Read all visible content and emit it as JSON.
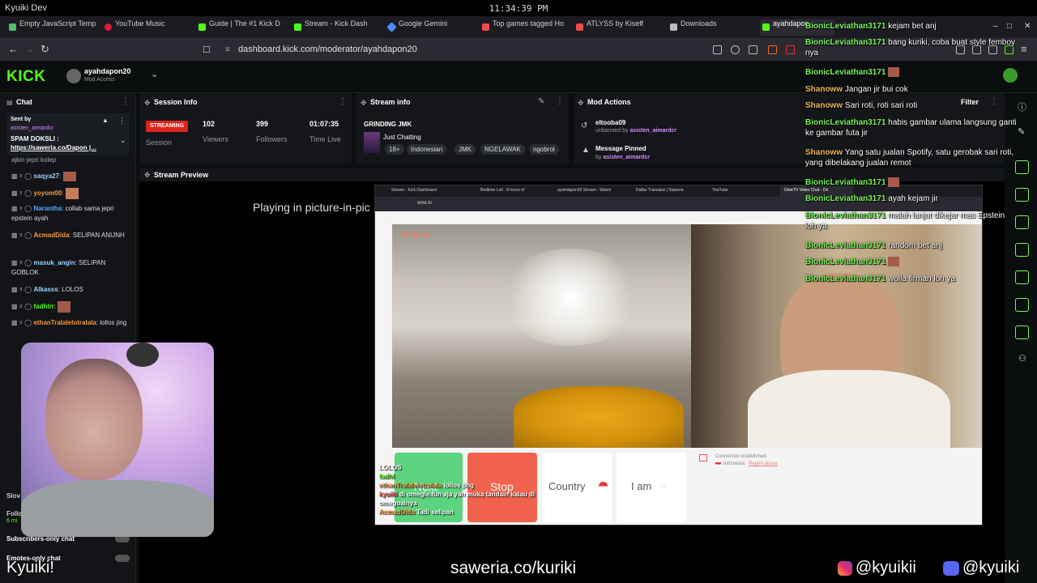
{
  "os": {
    "title": "Kyuiki Dev",
    "clock": "11:34:39 PM"
  },
  "tabs": [
    {
      "label": "Empty JavaScript Temp",
      "color": "#4fc36b"
    },
    {
      "label": "YouTube Music",
      "color": "#e21b3c"
    },
    {
      "label": "Guide | The #1 Kick D",
      "color": "#53fc18"
    },
    {
      "label": "Stream - Kick Dash",
      "color": "#53fc18"
    },
    {
      "label": "Google Gemini",
      "color": "#4a8cff"
    },
    {
      "label": "Top games tagged Ho",
      "color": "#f24a4a"
    },
    {
      "label": "ATLYSS by Kiseff",
      "color": "#f24a4a"
    },
    {
      "label": "Downloads",
      "color": "#bbbbbb"
    },
    {
      "label": "ayahdapon",
      "color": "#53fc18"
    }
  ],
  "url": "dashboard.kick.com/moderator/ayahdapon20",
  "kick": {
    "logo": "KICK",
    "channel": "ayahdapon20",
    "role": "Mod Access"
  },
  "chat": {
    "title": "Chat",
    "pinned_sent_by": "Sent by",
    "pinned_sender": "asisten_aimardcr",
    "pinned_text": "SPAM DOKSLI :",
    "pinned_link": "https://saweria.co/Dapon |...",
    "partial_top": "ajkin jepri kolep",
    "lines": [
      {
        "user": "saqya27",
        "msg": "",
        "color": "#9ad2ff"
      },
      {
        "user": "yoyom00",
        "msg": "",
        "color": "#f79a45"
      },
      {
        "user": "Narantha",
        "msg": "collab sama jepri epstein ayah",
        "color": "#57a6ff"
      },
      {
        "user": "AcmadDida",
        "msg": "SELIPAN ANIJNH",
        "color": "#f79a45"
      },
      {
        "user": "masuk_angin",
        "msg": "SELIPAN GOBLOK",
        "color": "#9ad2ff"
      },
      {
        "user": "Alkasss",
        "msg": "LOLOS",
        "color": "#9ad2ff"
      },
      {
        "user": "fadhlrr",
        "msg": "",
        "color": "#53fc18"
      },
      {
        "user": "ethanTralalelotralala",
        "msg": "lollos jing",
        "color": "#f79a45"
      }
    ],
    "settings": [
      {
        "label": "Subscribers-only chat"
      },
      {
        "label": "Emotes-only chat"
      }
    ],
    "partial_slow": "Slov",
    "partial_follow": "Follo",
    "partial_min": "6 mi"
  },
  "session": {
    "title": "Session Info",
    "status": "STREAMING",
    "status_label": "Session",
    "viewers": "102",
    "viewers_label": "Viewers",
    "followers": "399",
    "followers_label": "Followers",
    "time": "01:07:35",
    "time_label": "Time Live"
  },
  "stream_info": {
    "title": "Stream info",
    "stream_title": "GRINDING JMK",
    "category": "Just Chatting",
    "tags": [
      "18+",
      "Indonesian",
      "JMK",
      "NGELAWAK",
      "ngobrol"
    ]
  },
  "mod_actions": {
    "title": "Mod Actions",
    "filter": "Filter",
    "items": [
      {
        "user": "eltooba09",
        "detail": "unbanned by",
        "by": "asisten_aimardcr"
      },
      {
        "user": "Message Pinned",
        "detail": "by",
        "by": "asisten_aimardcr"
      }
    ]
  },
  "preview": {
    "title": "Stream Preview",
    "pip_text": "Playing in picture-in-pic"
  },
  "inner": {
    "tabs": [
      "Stream - Kick Dashboard",
      "Bedtime Lofi · 8 hours of",
      "ayahdapon20 Stream - Watch",
      "Daftar Transaksi | Saweria",
      "YouTube",
      "OmeTV Video Chat - On"
    ],
    "url": "ome.tv",
    "watermark": "Ome.tv",
    "buttons": {
      "next": "Next",
      "stop": "Stop",
      "country": "Country",
      "iam": "I am"
    },
    "conn_text": "Connection established.",
    "conn_country": "Indonesia.",
    "conn_report": "Report abuse",
    "overlay_chat": [
      {
        "user": "",
        "msg": "LOLOS"
      },
      {
        "user": "fadhl",
        "msg": ""
      },
      {
        "user": "ethanTralalelotralala",
        "msg": "lollos jing"
      },
      {
        "user": "kyuiki",
        "msg": "di omegle.fun aja yah muka tandain kalau di omegoalnya"
      },
      {
        "user": "AcmadDida",
        "msg": "Tadi selipan"
      }
    ]
  },
  "overlay": [
    {
      "user": "BionicLeviathan3171",
      "msg": "kejam bet anj",
      "style": "green"
    },
    {
      "user": "BionicLeviathan3171",
      "msg": "bang kuriki, coba buat style femboy nya",
      "style": "green"
    },
    {
      "user": "BionicLeviathan3171",
      "msg": "",
      "style": "green"
    },
    {
      "user": "Shanoww",
      "msg": "Jangan jir bui cok",
      "style": "orange"
    },
    {
      "user": "Shanoww",
      "msg": "Sari roti, roti sari roti",
      "style": "orange"
    },
    {
      "user": "BionicLeviathan3171",
      "msg": "habis gambar ulama langsung ganti ke gambar futa jir",
      "style": "green"
    },
    {
      "user": "Shanoww",
      "msg": "Yang satu jualan Spotify, satu gerobak sari roti, yang dibelakang jualan remot",
      "style": "orange"
    },
    {
      "user": "BionicLeviathan3171",
      "msg": "",
      "style": "green"
    },
    {
      "user": "BionicLeviathan3171",
      "msg": "ayah kejam jir",
      "style": "green"
    },
    {
      "user": "BionicLeviathan3171",
      "msg": "malah lanjut dikejar mas Epstein loh ya",
      "style": "green"
    },
    {
      "user": "BionicLeviathan3171",
      "msg": "random bet anj",
      "style": "green"
    },
    {
      "user": "BionicLeviathan3171",
      "msg": "",
      "style": "green"
    },
    {
      "user": "BionicLeviathan3171",
      "msg": "woila firman loh ya",
      "style": "green"
    }
  ],
  "bottom": {
    "streamer": "Kyuiki!",
    "saweria": "saweria.co/kuriki",
    "instagram": "@kyuikii",
    "discord": "@kyuiki"
  },
  "colors": {
    "kick_green": "#53fc18",
    "streaming_red": "#e0241c",
    "stop_red": "#f0624b",
    "next_green": "#5cd37e"
  }
}
